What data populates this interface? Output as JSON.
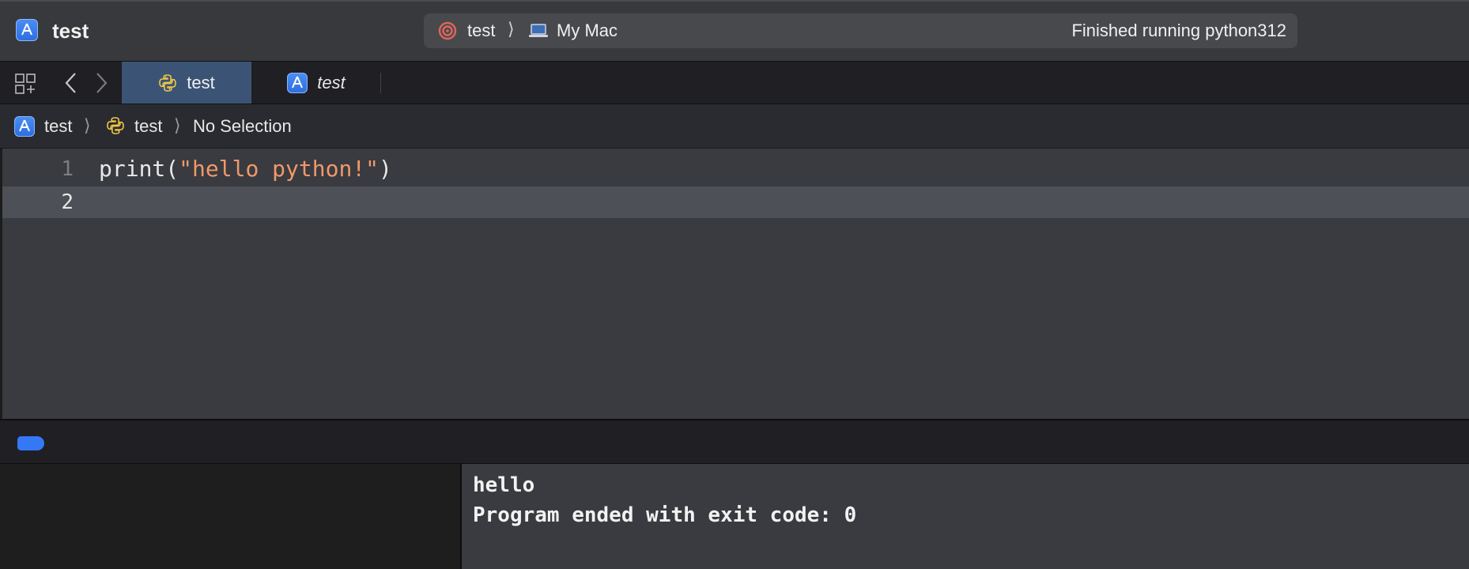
{
  "window": {
    "project_title": "test",
    "scheme": "test",
    "scheme_separator": "⟩",
    "destination": "My Mac",
    "status": "Finished running python312"
  },
  "tabs": [
    {
      "label": "test",
      "icon": "python-file-icon",
      "active": true
    },
    {
      "label": "test",
      "icon": "xcode-project-icon",
      "active": false
    }
  ],
  "breadcrumb": {
    "project": "test",
    "file": "test",
    "symbol": "No Selection",
    "separator": "⟩"
  },
  "editor": {
    "lines": [
      {
        "number": "1",
        "code_prefix": "print(",
        "string": "\"hello python!\"",
        "code_suffix": ")"
      },
      {
        "number": "2",
        "code_prefix": "",
        "string": "",
        "code_suffix": ""
      }
    ]
  },
  "console": {
    "output": [
      "hello",
      "Program ended with exit code: 0"
    ]
  },
  "colors": {
    "accent": "#3478f6",
    "string_literal": "#f0986a",
    "active_tab": "#3b5475",
    "current_line": "#4d5056"
  }
}
